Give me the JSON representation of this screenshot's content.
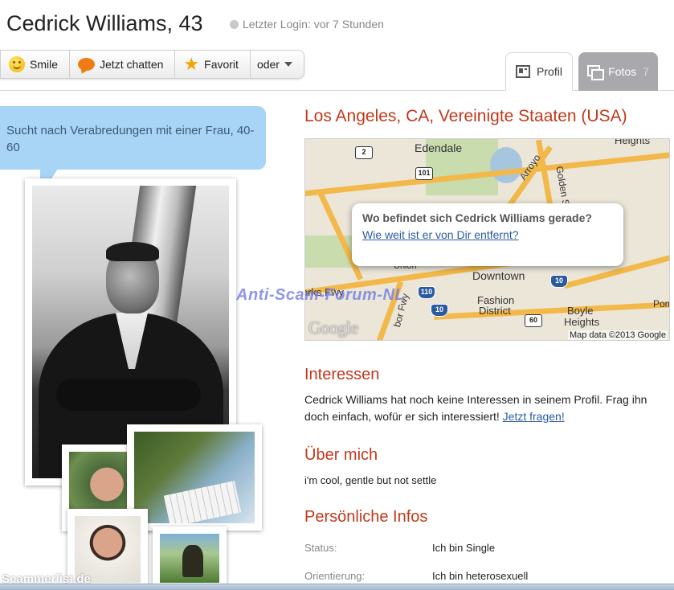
{
  "header": {
    "name_age": "Cedrick Williams, 43",
    "last_login": "Letzter Login: vor 7 Stunden"
  },
  "actions": {
    "smile": "Smile",
    "chat": "Jetzt chatten",
    "favorite": "Favorit",
    "more": "oder"
  },
  "tabs": {
    "profil": "Profil",
    "fotos": "Fotos",
    "fotos_count": "7"
  },
  "bubble": {
    "text": "Sucht nach Verabredungen mit einer Frau, 40-60"
  },
  "photos": {
    "watermark_bottom": "Scammerlist.de"
  },
  "location": "Los Angeles, CA, Vereinigte Staaten (USA)",
  "map": {
    "labels": {
      "edendale": "Edendale",
      "downtown": "Downtown",
      "fashion": "Fashion",
      "district": "District",
      "boyle": "Boyle",
      "heights": "Heights",
      "heights_top": "Heights",
      "parks_fwy": "arks Fwy",
      "arroyo": "Arroyo",
      "golden": "Golden Stat",
      "harbor": "bor Fwy",
      "union": "Union",
      "pom": "Pom"
    },
    "shields": [
      "2",
      "101",
      "110",
      "10",
      "10",
      "60"
    ],
    "google": "Google",
    "data": "Map data ©2013 Google",
    "popup_question": "Wo befindet sich Cedrick Williams gerade?",
    "popup_link": "Wie weit ist er von Dir entfernt?"
  },
  "watermark": "Anti-Scam-Forum-NL",
  "interessen": {
    "title": "Interessen",
    "text": "Cedrick Williams hat noch keine Interessen in seinem Profil. Frag ihn doch einfach, wofür er sich interessiert!",
    "link": "Jetzt fragen!"
  },
  "ueber": {
    "title": "Über mich",
    "text": "i'm cool, gentle but not settle"
  },
  "infos": {
    "title": "Persönliche Infos",
    "rows": [
      {
        "label": "Status:",
        "value": "Ich bin Single"
      },
      {
        "label": "Orientierung:",
        "value": "Ich bin heterosexuell"
      }
    ]
  },
  "colors": {
    "accent": "#c0391b",
    "bubble": "#a8d5f5",
    "link": "#2a5aa0"
  }
}
